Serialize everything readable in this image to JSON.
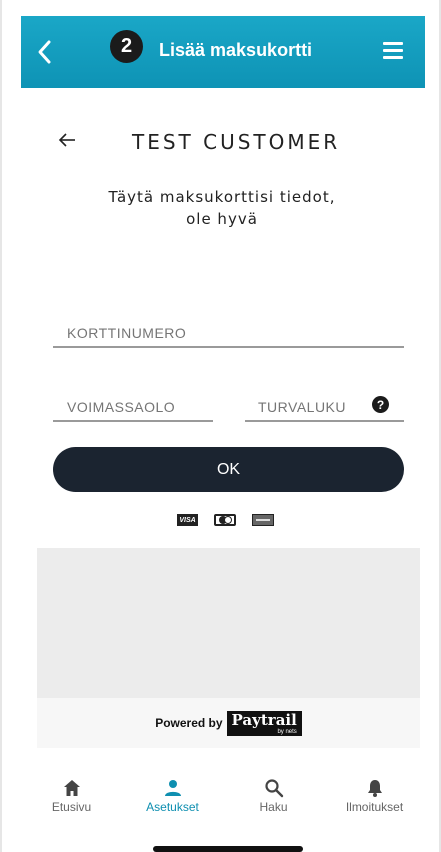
{
  "header": {
    "title": "Lisää maksukortti",
    "step_number": "2",
    "back_icon": "chevron-left-icon",
    "menu_icon": "hamburger-menu-icon",
    "color": "#1aa7c7"
  },
  "customer": {
    "name": "TEST CUSTOMER",
    "back_icon": "arrow-left-icon"
  },
  "instructions": {
    "line1": "Täytä maksukorttisi tiedot,",
    "line2": "ole hyvä"
  },
  "form": {
    "card_number_placeholder": "KORTTINUMERO",
    "expiry_placeholder": "VOIMASSAOLO",
    "cvc_placeholder": "TURVALUKU",
    "help_symbol": "?",
    "submit_label": "OK"
  },
  "card_logos": {
    "visa": "VISA"
  },
  "powered": {
    "text": "Powered by",
    "brand": "Paytrail",
    "brand_sub": "by nets"
  },
  "bottom_nav": {
    "items": [
      {
        "label": "Etusivu",
        "icon": "home-icon"
      },
      {
        "label": "Asetukset",
        "icon": "person-icon",
        "active": true
      },
      {
        "label": "Haku",
        "icon": "search-icon"
      },
      {
        "label": "Ilmoitukset",
        "icon": "bell-icon"
      }
    ],
    "active_color": "#0e8fb0"
  }
}
